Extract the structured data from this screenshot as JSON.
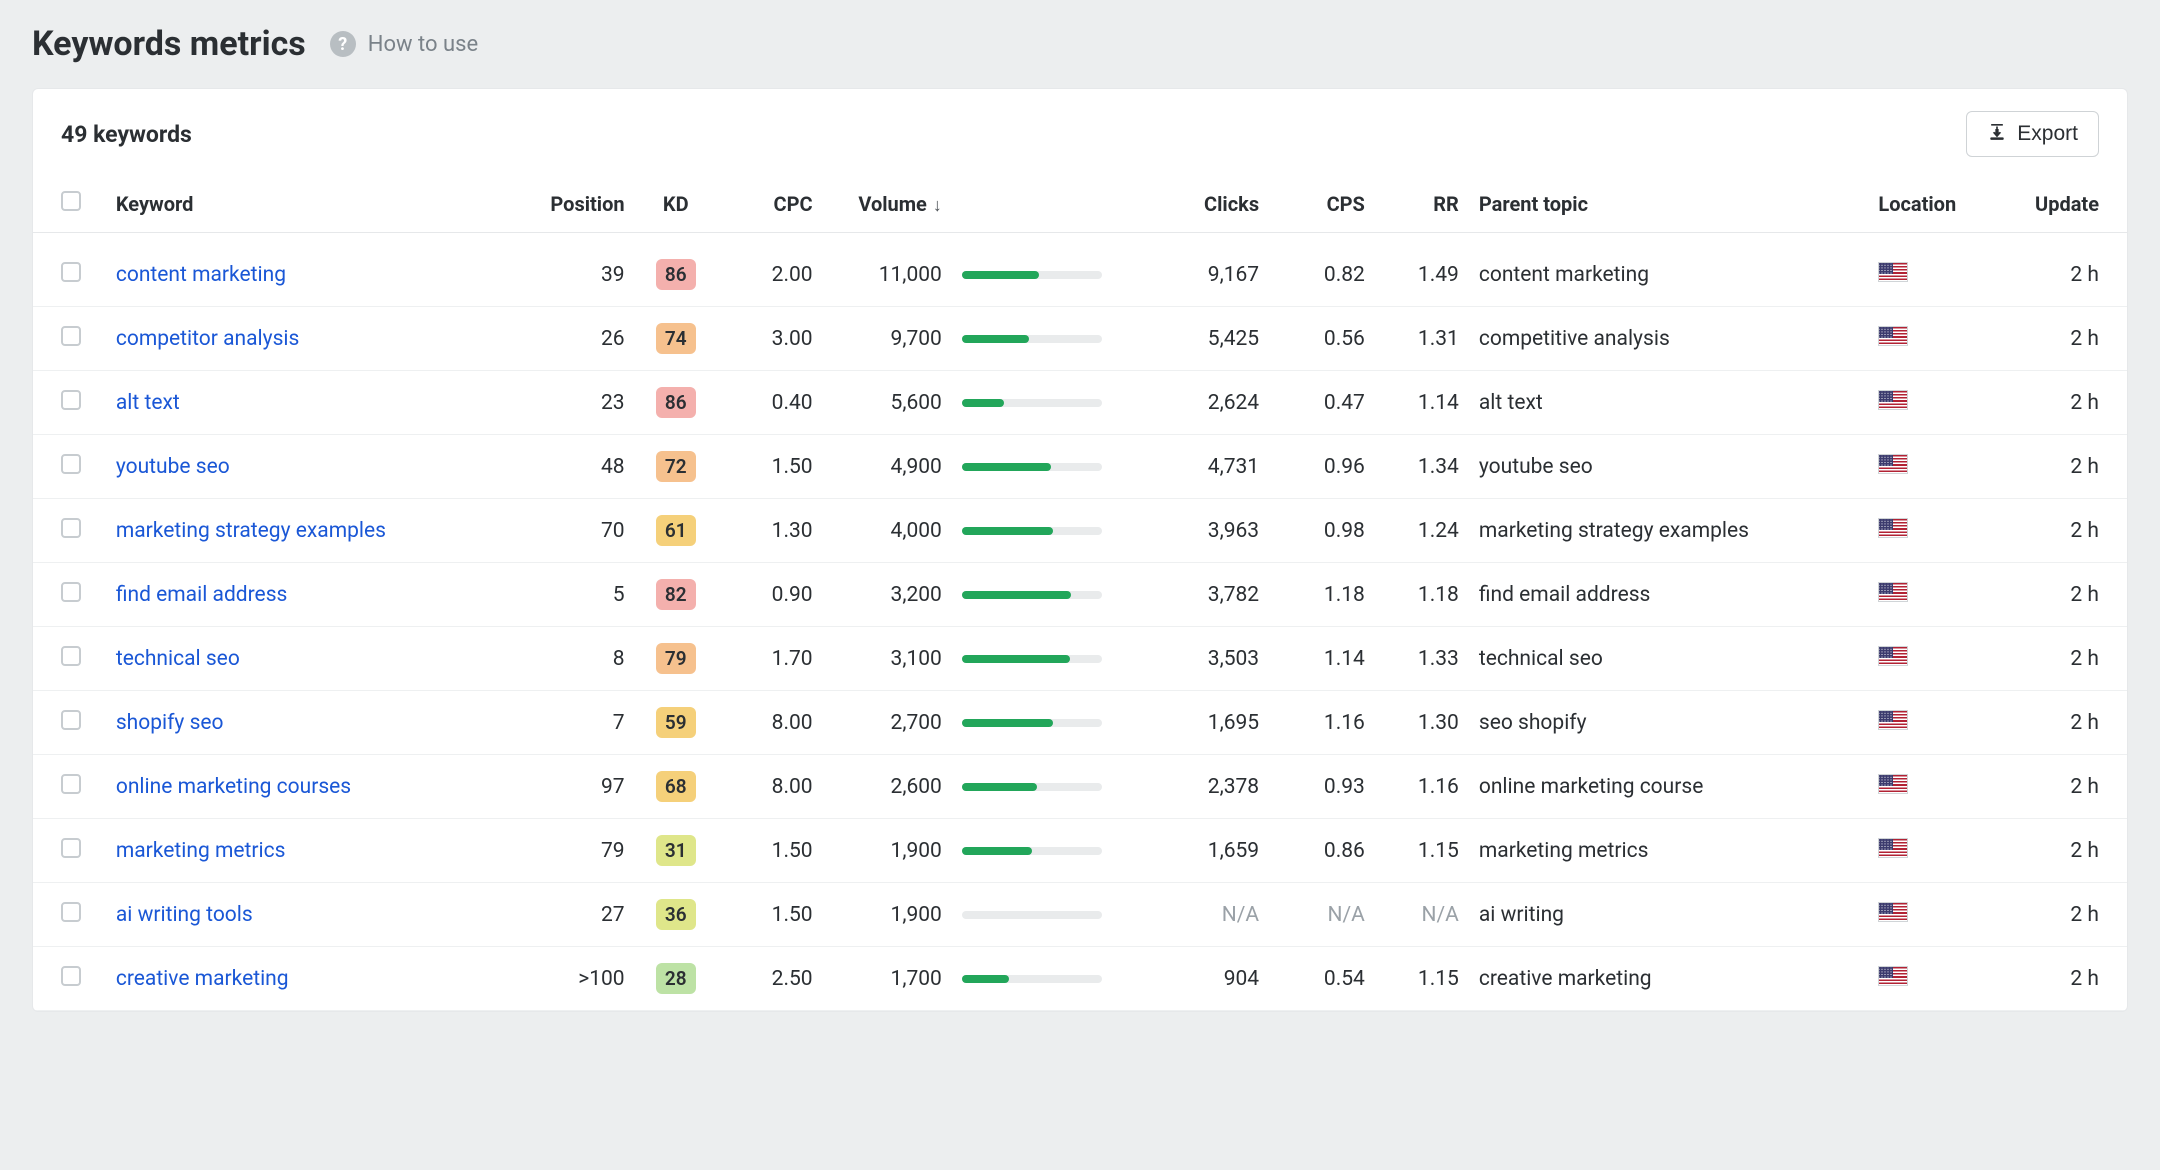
{
  "page_title": "Keywords metrics",
  "howto_label": "How to use",
  "count_text": "49 keywords",
  "export_label": "Export",
  "columns": {
    "keyword": "Keyword",
    "position": "Position",
    "kd": "KD",
    "cpc": "CPC",
    "volume": "Volume",
    "clicks": "Clicks",
    "cps": "CPS",
    "rr": "RR",
    "parent": "Parent topic",
    "location": "Location",
    "update": "Update"
  },
  "sort_column": "volume",
  "sort_dir": "desc",
  "max_volume": 11000,
  "rows": [
    {
      "keyword": "content marketing",
      "position": "39",
      "kd": 86,
      "cpc": "2.00",
      "volume": 11000,
      "volume_txt": "11,000",
      "bar_pct": 55,
      "clicks": "9,167",
      "cps": "0.82",
      "rr": "1.49",
      "parent": "content marketing",
      "location": "US",
      "update": "2 h"
    },
    {
      "keyword": "competitor analysis",
      "position": "26",
      "kd": 74,
      "cpc": "3.00",
      "volume": 9700,
      "volume_txt": "9,700",
      "bar_pct": 48,
      "clicks": "5,425",
      "cps": "0.56",
      "rr": "1.31",
      "parent": "competitive analysis",
      "location": "US",
      "update": "2 h"
    },
    {
      "keyword": "alt text",
      "position": "23",
      "kd": 86,
      "cpc": "0.40",
      "volume": 5600,
      "volume_txt": "5,600",
      "bar_pct": 30,
      "clicks": "2,624",
      "cps": "0.47",
      "rr": "1.14",
      "parent": "alt text",
      "location": "US",
      "update": "2 h"
    },
    {
      "keyword": "youtube seo",
      "position": "48",
      "kd": 72,
      "cpc": "1.50",
      "volume": 4900,
      "volume_txt": "4,900",
      "bar_pct": 64,
      "clicks": "4,731",
      "cps": "0.96",
      "rr": "1.34",
      "parent": "youtube seo",
      "location": "US",
      "update": "2 h"
    },
    {
      "keyword": "marketing strategy examples",
      "position": "70",
      "kd": 61,
      "cpc": "1.30",
      "volume": 4000,
      "volume_txt": "4,000",
      "bar_pct": 65,
      "clicks": "3,963",
      "cps": "0.98",
      "rr": "1.24",
      "parent": "marketing strategy examples",
      "location": "US",
      "update": "2 h"
    },
    {
      "keyword": "find email address",
      "position": "5",
      "kd": 82,
      "cpc": "0.90",
      "volume": 3200,
      "volume_txt": "3,200",
      "bar_pct": 78,
      "clicks": "3,782",
      "cps": "1.18",
      "rr": "1.18",
      "parent": "find email address",
      "location": "US",
      "update": "2 h"
    },
    {
      "keyword": "technical seo",
      "position": "8",
      "kd": 79,
      "cpc": "1.70",
      "volume": 3100,
      "volume_txt": "3,100",
      "bar_pct": 77,
      "clicks": "3,503",
      "cps": "1.14",
      "rr": "1.33",
      "parent": "technical seo",
      "location": "US",
      "update": "2 h"
    },
    {
      "keyword": "shopify seo",
      "position": "7",
      "kd": 59,
      "cpc": "8.00",
      "volume": 2700,
      "volume_txt": "2,700",
      "bar_pct": 65,
      "clicks": "1,695",
      "cps": "1.16",
      "rr": "1.30",
      "parent": "seo shopify",
      "location": "US",
      "update": "2 h"
    },
    {
      "keyword": "online marketing courses",
      "position": "97",
      "kd": 68,
      "cpc": "8.00",
      "volume": 2600,
      "volume_txt": "2,600",
      "bar_pct": 54,
      "clicks": "2,378",
      "cps": "0.93",
      "rr": "1.16",
      "parent": "online marketing course",
      "location": "US",
      "update": "2 h"
    },
    {
      "keyword": "marketing metrics",
      "position": "79",
      "kd": 31,
      "cpc": "1.50",
      "volume": 1900,
      "volume_txt": "1,900",
      "bar_pct": 50,
      "clicks": "1,659",
      "cps": "0.86",
      "rr": "1.15",
      "parent": "marketing metrics",
      "location": "US",
      "update": "2 h"
    },
    {
      "keyword": "ai writing tools",
      "position": "27",
      "kd": 36,
      "cpc": "1.50",
      "volume": 1900,
      "volume_txt": "1,900",
      "bar_pct": 0,
      "clicks": "N/A",
      "cps": "N/A",
      "rr": "N/A",
      "parent": "ai writing",
      "location": "US",
      "update": "2 h"
    },
    {
      "keyword": "creative marketing",
      "position": ">100",
      "kd": 28,
      "cpc": "2.50",
      "volume": 1700,
      "volume_txt": "1,700",
      "bar_pct": 34,
      "clicks": "904",
      "cps": "0.54",
      "rr": "1.15",
      "parent": "creative marketing",
      "location": "US",
      "update": "2 h"
    }
  ],
  "kd_colors": {
    "red": "#f4b0ad",
    "orange": "#f6c18e",
    "amber": "#f5d07a",
    "lime": "#dfe68a",
    "green": "#bde2a5"
  }
}
